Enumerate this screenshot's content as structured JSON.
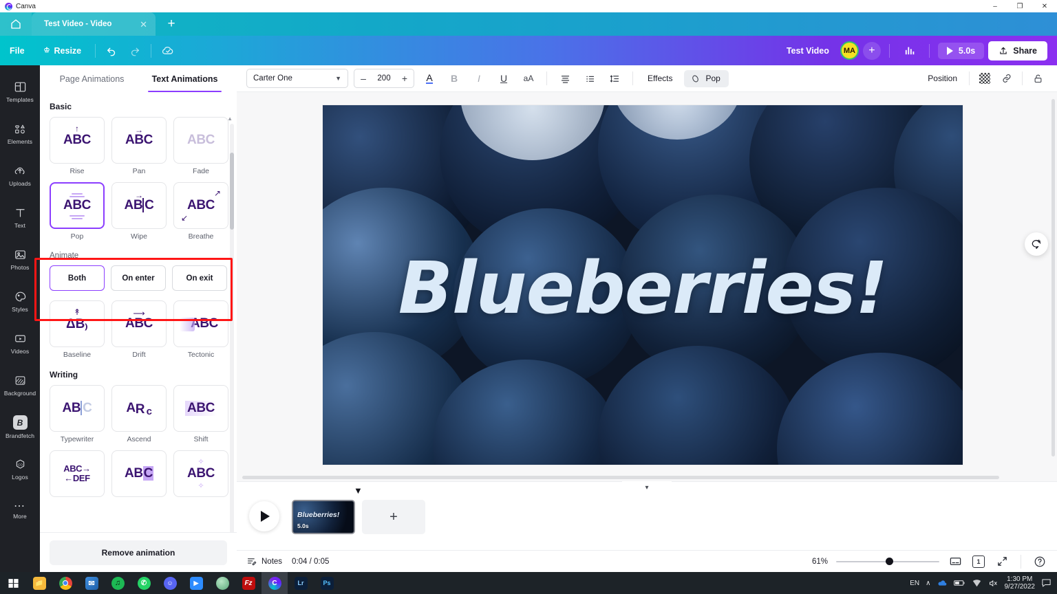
{
  "window": {
    "app_title": "Canva",
    "minimize": "–",
    "maximize": "❐",
    "close": "✕"
  },
  "tabstrip": {
    "home_icon": "home-icon",
    "tab_label": "Test Video - Video",
    "tab_close": "✕",
    "new_tab": "+"
  },
  "header": {
    "file": "File",
    "resize": "Resize",
    "undo_icon": "undo-icon",
    "redo_icon": "redo-icon",
    "cloud_icon": "cloud-saved-icon",
    "doc_name": "Test Video",
    "avatar_initials": "MA",
    "add_collaborator": "+",
    "insights_icon": "insights-icon",
    "duration": "5.0s",
    "share": "Share"
  },
  "rail": {
    "items": [
      {
        "label": "Templates",
        "icon": "templates-icon"
      },
      {
        "label": "Elements",
        "icon": "elements-icon"
      },
      {
        "label": "Uploads",
        "icon": "uploads-icon"
      },
      {
        "label": "Text",
        "icon": "text-icon"
      },
      {
        "label": "Photos",
        "icon": "photos-icon"
      },
      {
        "label": "Styles",
        "icon": "styles-icon"
      },
      {
        "label": "Videos",
        "icon": "videos-icon"
      },
      {
        "label": "Background",
        "icon": "background-icon"
      },
      {
        "label": "Brandfetch",
        "icon": "brandfetch-icon"
      },
      {
        "label": "Logos",
        "icon": "logos-icon"
      },
      {
        "label": "More",
        "icon": "more-icon"
      }
    ]
  },
  "panel": {
    "tabs": [
      {
        "label": "Page Animations",
        "active": false
      },
      {
        "label": "Text Animations",
        "active": true
      }
    ],
    "sections": [
      {
        "title": "Basic",
        "items": [
          {
            "label": "Rise",
            "selected": false
          },
          {
            "label": "Pan",
            "selected": false
          },
          {
            "label": "Fade",
            "selected": false
          },
          {
            "label": "Pop",
            "selected": true
          },
          {
            "label": "Wipe",
            "selected": false
          },
          {
            "label": "Breathe",
            "selected": false
          }
        ]
      }
    ],
    "animate": {
      "label": "Animate",
      "options": [
        {
          "label": "Both",
          "selected": true
        },
        {
          "label": "On enter",
          "selected": false
        },
        {
          "label": "On exit",
          "selected": false
        }
      ]
    },
    "more_basic": [
      {
        "label": "Baseline"
      },
      {
        "label": "Drift"
      },
      {
        "label": "Tectonic"
      }
    ],
    "writing": {
      "title": "Writing",
      "items": [
        {
          "label": "Typewriter"
        },
        {
          "label": "Ascend"
        },
        {
          "label": "Shift"
        }
      ],
      "row2": [
        {
          "label": "ABC→←DEF"
        },
        {
          "label": "ABC"
        },
        {
          "label": "ABC"
        }
      ]
    },
    "remove_animation": "Remove animation"
  },
  "toolbar": {
    "font_family": "Carter One",
    "font_size": "200",
    "decrease": "–",
    "increase": "+",
    "text_color_icon": "text-color-icon",
    "bold": "B",
    "italic": "I",
    "underline": "U",
    "case": "aA",
    "align_icon": "align-icon",
    "list_icon": "bullet-list-icon",
    "spacing_icon": "line-spacing-icon",
    "effects": "Effects",
    "animate_pill": "Pop",
    "position": "Position",
    "transparency_icon": "transparency-icon",
    "link_icon": "link-icon",
    "lock_icon": "lock-icon"
  },
  "canvas": {
    "headline": "Blueberries!",
    "comment_icon": "add-comment-icon"
  },
  "timeline": {
    "collapse_icon": "chevron-down-icon",
    "play_icon": "play-icon",
    "page_title": "Blueberries!",
    "page_duration": "5.0s",
    "add_page": "+"
  },
  "statusbar": {
    "notes_icon": "notes-icon",
    "notes": "Notes",
    "time": "0:04 / 0:05",
    "zoom": "61%",
    "present_icon": "present-icon",
    "pages_icon": "pages-icon",
    "page_number": "1",
    "fullscreen_icon": "fullscreen-icon",
    "help_icon": "help-icon"
  },
  "taskbar": {
    "items": [
      {
        "name": "start",
        "glyph": "⊞",
        "color": "#1d2328",
        "text": "#ffffff"
      },
      {
        "name": "file-explorer",
        "glyph": "▤",
        "color": "#f6b93b",
        "text": "#5b4206"
      },
      {
        "name": "google-chrome",
        "glyph": "◉",
        "color": "#e8453c",
        "text": "#ffffff"
      },
      {
        "name": "mail",
        "glyph": "✉",
        "color": "#2b7fd4",
        "text": "#ffffff"
      },
      {
        "name": "spotify",
        "glyph": "♫",
        "color": "#1db954",
        "text": "#052a10"
      },
      {
        "name": "whatsapp",
        "glyph": "✆",
        "color": "#25d366",
        "text": "#ffffff"
      },
      {
        "name": "discord",
        "glyph": "◕",
        "color": "#5865f2",
        "text": "#ffffff"
      },
      {
        "name": "zoom",
        "glyph": "▶",
        "color": "#2d8cff",
        "text": "#ffffff"
      },
      {
        "name": "app-green",
        "glyph": "●",
        "color": "#6dbf8b",
        "text": "#ffffff"
      },
      {
        "name": "filezilla",
        "glyph": "Fz",
        "color": "#bf0d0d",
        "text": "#ffffff"
      },
      {
        "name": "canva",
        "glyph": "C",
        "color": "#2fc6d8",
        "text": "#ffffff",
        "active": true
      },
      {
        "name": "lightroom",
        "glyph": "Lr",
        "color": "#0b1f3a",
        "text": "#8fd0ff"
      },
      {
        "name": "photoshop",
        "glyph": "Ps",
        "color": "#0b1f3a",
        "text": "#55c1ff"
      }
    ],
    "tray": {
      "language": "EN",
      "chevron": "∧",
      "cloud_icon": "onedrive-icon",
      "battery_icon": "battery-icon",
      "wifi_icon": "wifi-icon",
      "volume_icon": "volume-muted-icon",
      "time": "1:30 PM",
      "date": "9/27/2022",
      "notifications_icon": "notifications-icon"
    }
  }
}
